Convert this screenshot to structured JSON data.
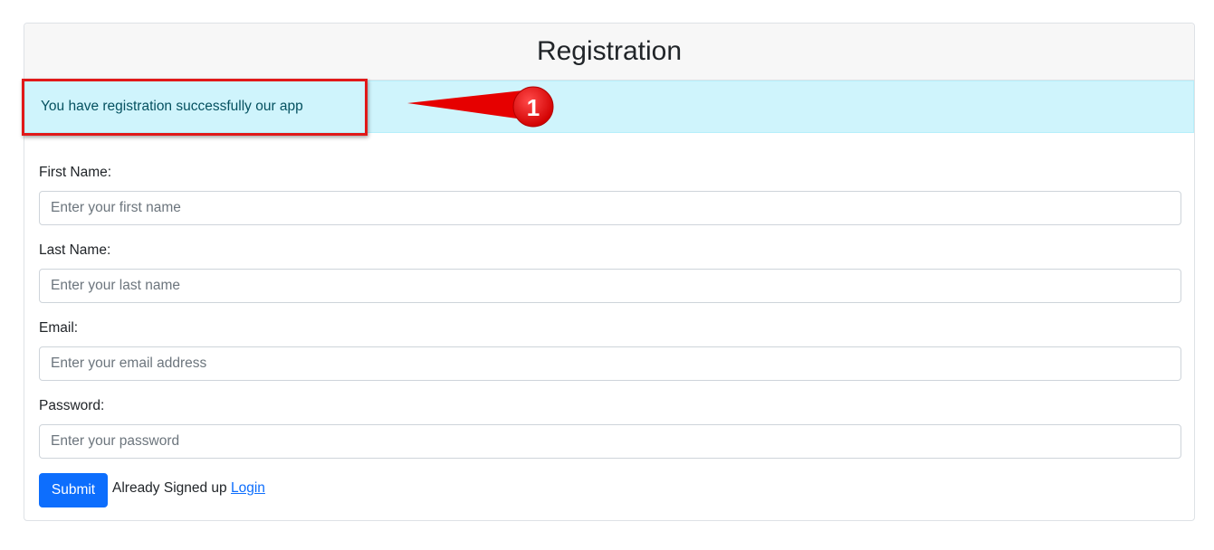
{
  "header": {
    "title": "Registration"
  },
  "alert": {
    "message": "You have registration successfully our app"
  },
  "annotation": {
    "number": "1",
    "color": "#e11919"
  },
  "form": {
    "first_name": {
      "label": "First Name:",
      "placeholder": "Enter your first name"
    },
    "last_name": {
      "label": "Last Name:",
      "placeholder": "Enter your last name"
    },
    "email": {
      "label": "Email:",
      "placeholder": "Enter your email address"
    },
    "password": {
      "label": "Password:",
      "placeholder": "Enter your password"
    },
    "submit_label": "Submit",
    "already_text": "Already Signed up",
    "login_link": "Login"
  },
  "colors": {
    "primary": "#0d6efd",
    "alert_bg": "#cff4fc",
    "alert_text": "#055160"
  }
}
